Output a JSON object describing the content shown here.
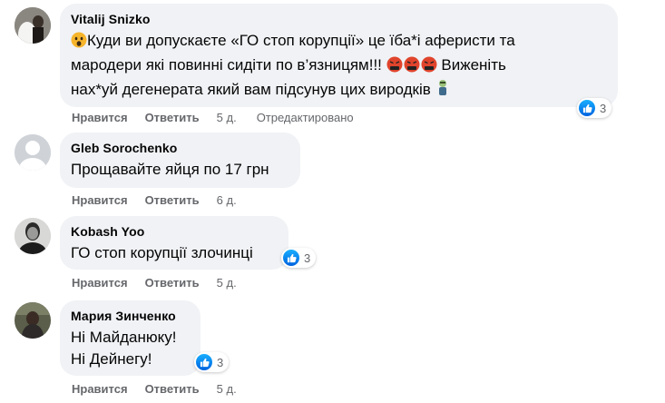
{
  "labels": {
    "like": "Нравится",
    "reply": "Ответить",
    "edited": "Отредактировано"
  },
  "comments": [
    {
      "author": "Vitalij Snizko",
      "lines": [
        "Куди ви допускаєте «ГО стоп корупції» це їба*і аферисти та",
        "мародери які повинні сидіти по в’язницям!!!",
        "Виженіть",
        "нах*уй дегенерата який вам підсунув цих виродків"
      ],
      "time": "5 д.",
      "reactions": "3"
    },
    {
      "author": "Gleb Sorochenko",
      "lines": [
        "Прощавайте яйця по 17 грн"
      ],
      "time": "6 д."
    },
    {
      "author": "Kobash Yoo",
      "lines": [
        "ГО стоп корупції злочинці"
      ],
      "time": "5 д.",
      "reactions": "3"
    },
    {
      "author": "Мария Зинченко",
      "lines": [
        "Ні Майданюку!",
        "Ні Дейнегу!"
      ],
      "time": "5 д.",
      "reactions": "3"
    }
  ]
}
